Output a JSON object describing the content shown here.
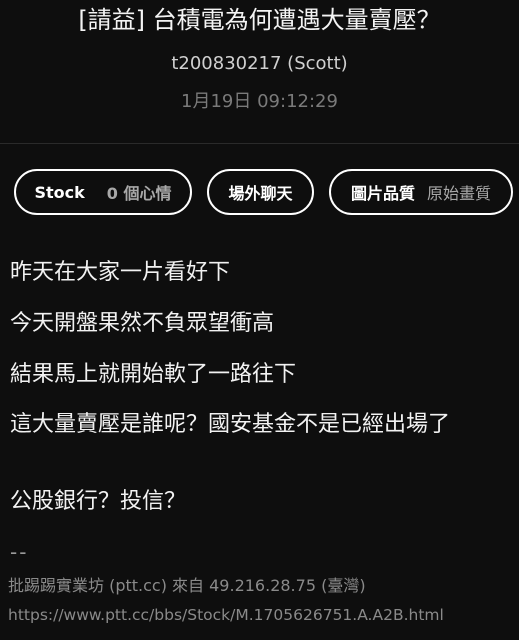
{
  "post": {
    "title": "[請益] 台積電為何遭遇大量賣壓？",
    "author": "t200830217 (Scott)",
    "time": "1月19日 09:12:29"
  },
  "chips": {
    "board": "Stock",
    "reaction": "0 個心情",
    "offtopic": "場外聊天",
    "quality_label": "圖片品質",
    "quality_value": "原始畫質"
  },
  "body": {
    "p1": "昨天在大家一片看好下",
    "p2": "今天開盤果然不負眾望衝高",
    "p3": "結果馬上就開始軟了一路往下",
    "p4": "這大量賣壓是誰呢？國安基金不是已經出場了",
    "p5": "公股銀行？投信？"
  },
  "footer": {
    "signature": "--",
    "source": "批踢踢實業坊 (ptt.cc) 來自 49.216.28.75 (臺灣)",
    "url": "https://www.ptt.cc/bbs/Stock/M.1705626751.A.A2B.html"
  }
}
